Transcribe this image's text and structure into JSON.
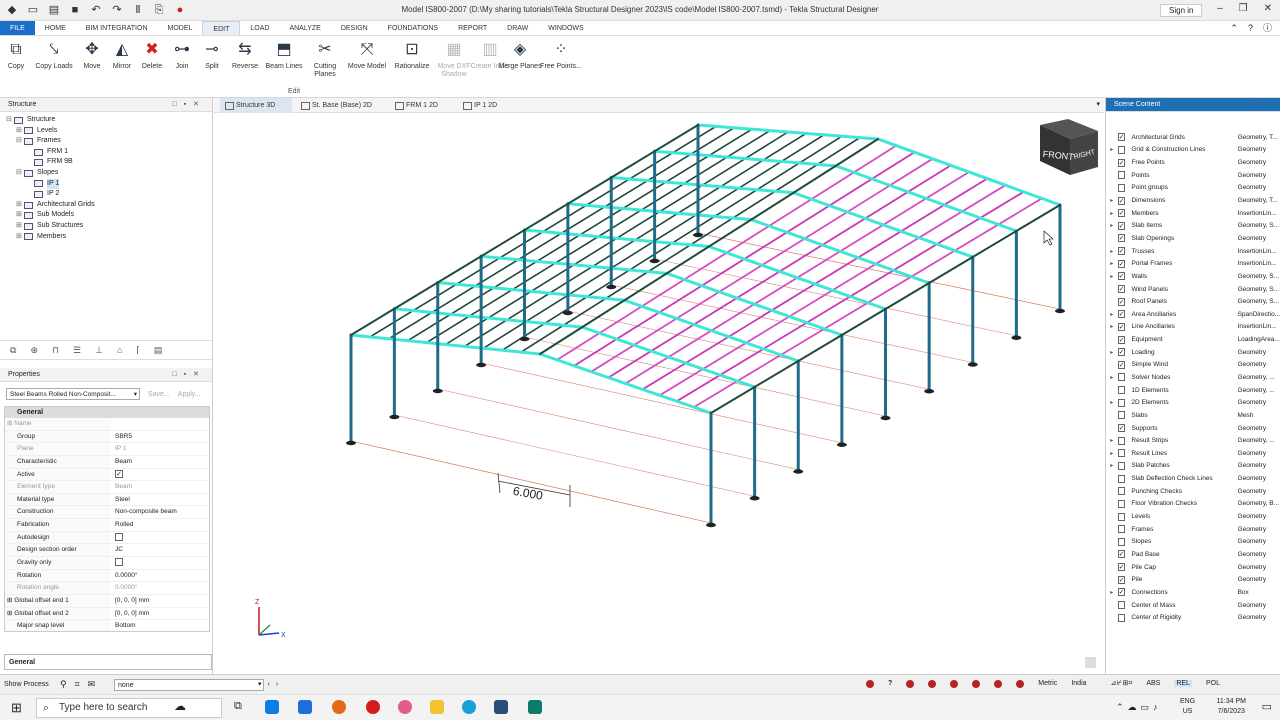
{
  "window": {
    "title": "Model IS800-2007 (D:\\My sharing tutorials\\Tekla Structural Designer 2023\\IS code\\Model IS800-2007.tsmd) - Tekla Structural Designer",
    "sign_in": "Sign in"
  },
  "menu": {
    "tabs": [
      "FILE",
      "HOME",
      "BIM INTEGRATION",
      "MODEL",
      "EDIT",
      "LOAD",
      "ANALYZE",
      "DESIGN",
      "FOUNDATIONS",
      "REPORT",
      "DRAW",
      "WINDOWS"
    ],
    "active": "EDIT"
  },
  "ribbon": {
    "group_label": "Edit",
    "buttons": [
      {
        "label": "Copy",
        "icon": "copy-icon",
        "enabled": true
      },
      {
        "label": "Copy Loads",
        "icon": "copy-loads-icon",
        "enabled": true
      },
      {
        "label": "Move",
        "icon": "move-icon",
        "enabled": true
      },
      {
        "label": "Mirror",
        "icon": "mirror-icon",
        "enabled": true
      },
      {
        "label": "Delete",
        "icon": "delete-icon",
        "enabled": true
      },
      {
        "label": "Join",
        "icon": "join-icon",
        "enabled": true
      },
      {
        "label": "Split",
        "icon": "split-icon",
        "enabled": true
      },
      {
        "label": "Reverse",
        "icon": "reverse-icon",
        "enabled": true
      },
      {
        "label": "Beam Lines",
        "icon": "beam-lines-icon",
        "enabled": true
      },
      {
        "label": "Cutting Planes",
        "icon": "scissors-icon",
        "enabled": true
      },
      {
        "label": "Move Model",
        "icon": "move-model-icon",
        "enabled": true
      },
      {
        "label": "Rationalize",
        "icon": "rationalize-icon",
        "enabled": true
      },
      {
        "label": "Move DXF Shadow",
        "icon": "dxf-icon",
        "enabled": false
      },
      {
        "label": "Create Infills",
        "icon": "infill-icon",
        "enabled": false
      },
      {
        "label": "Merge Planes",
        "icon": "merge-icon",
        "enabled": true
      },
      {
        "label": "Free Points...",
        "icon": "free-points-icon",
        "enabled": true
      }
    ]
  },
  "structure_panel": {
    "title": "Structure",
    "tree": [
      {
        "label": "Structure",
        "level": 0,
        "exp": "−"
      },
      {
        "label": "Levels",
        "level": 1,
        "exp": "+"
      },
      {
        "label": "Frames",
        "level": 1,
        "exp": "−"
      },
      {
        "label": "FRM 1",
        "level": 2,
        "exp": ""
      },
      {
        "label": "FRM 9B",
        "level": 2,
        "exp": ""
      },
      {
        "label": "Slopes",
        "level": 1,
        "exp": "−"
      },
      {
        "label": "IP 1",
        "level": 2,
        "exp": "",
        "selected": true
      },
      {
        "label": "IP 2",
        "level": 2,
        "exp": ""
      },
      {
        "label": "Architectural Grids",
        "level": 1,
        "exp": "+"
      },
      {
        "label": "Sub Models",
        "level": 1,
        "exp": "+"
      },
      {
        "label": "Sub Structures",
        "level": 1,
        "exp": "+"
      },
      {
        "label": "Members",
        "level": 1,
        "exp": "+"
      }
    ]
  },
  "properties": {
    "title": "Properties",
    "selector": "Steel Beams Rolled Non-Composit...",
    "save": "Save...",
    "apply": "Apply...",
    "section": "General",
    "rows": [
      {
        "k": "Name",
        "v": "",
        "dim": true,
        "exp": true
      },
      {
        "k": "Group",
        "v": "SBR5"
      },
      {
        "k": "Plane",
        "v": "IP 1",
        "dim": true
      },
      {
        "k": "Characteristic",
        "v": "Beam"
      },
      {
        "k": "Active",
        "v": "",
        "cb": true,
        "checked": true
      },
      {
        "k": "Element type",
        "v": "Beam",
        "dim": true
      },
      {
        "k": "Material type",
        "v": "Steel"
      },
      {
        "k": "Construction",
        "v": "Non-composite beam"
      },
      {
        "k": "Fabrication",
        "v": "Rolled"
      },
      {
        "k": "Autodesign",
        "v": "",
        "cb": true,
        "checked": false
      },
      {
        "k": "Design section order",
        "v": "JC"
      },
      {
        "k": "Gravity only",
        "v": "",
        "cb": true,
        "checked": false
      },
      {
        "k": "Rotation",
        "v": "0.0000°"
      },
      {
        "k": "Rotation angle",
        "v": "0.0000°",
        "dim": true
      },
      {
        "k": "Global offset end 1",
        "v": "[0, 0, 0] mm",
        "exp": true
      },
      {
        "k": "Global offset end 2",
        "v": "[0, 0, 0] mm",
        "exp": true
      },
      {
        "k": "Major snap level",
        "v": "Bottom"
      }
    ],
    "footer": "General"
  },
  "view_tabs": [
    "Structure 3D",
    "St. Base (Base) 2D",
    "FRM 1 2D",
    "IP 1 2D"
  ],
  "viewport": {
    "dimension": "6.000",
    "nav_cube": {
      "front": "FRONT",
      "right": "RIGHT"
    },
    "axes": {
      "x": "X",
      "z": "Z"
    }
  },
  "scene": {
    "title": "Scene Content",
    "items": [
      {
        "n": "Architectural Grids",
        "t": "Geometry, T...",
        "c": true,
        "e": ""
      },
      {
        "n": "Grid & Construction Lines",
        "t": "Geometry",
        "c": false,
        "e": "▸"
      },
      {
        "n": "Free Points",
        "t": "Geometry",
        "c": true,
        "e": ""
      },
      {
        "n": "Points",
        "t": "Geometry",
        "c": false,
        "e": ""
      },
      {
        "n": "Point groups",
        "t": "Geometry",
        "c": false,
        "e": ""
      },
      {
        "n": "Dimensions",
        "t": "Geometry, T...",
        "c": true,
        "e": "▸"
      },
      {
        "n": "Members",
        "t": "InsertionLin...",
        "c": true,
        "e": "▸"
      },
      {
        "n": "Slab Items",
        "t": "Geometry, S...",
        "c": true,
        "e": "▸"
      },
      {
        "n": "Slab Openings",
        "t": "Geometry",
        "c": true,
        "e": ""
      },
      {
        "n": "Trusses",
        "t": "InsertionLin...",
        "c": true,
        "e": "▸"
      },
      {
        "n": "Portal Frames",
        "t": "InsertionLin...",
        "c": true,
        "e": "▸"
      },
      {
        "n": "Walls",
        "t": "Geometry, S...",
        "c": true,
        "e": "▸"
      },
      {
        "n": "Wind Panels",
        "t": "Geometry, S...",
        "c": true,
        "e": ""
      },
      {
        "n": "Roof Panels",
        "t": "Geometry, S...",
        "c": true,
        "e": ""
      },
      {
        "n": "Area Ancillaries",
        "t": "SpanDirectio...",
        "c": true,
        "e": "▸"
      },
      {
        "n": "Line Ancillaries",
        "t": "InsertionLin...",
        "c": true,
        "e": "▸"
      },
      {
        "n": "Equipment",
        "t": "LoadingArea...",
        "c": true,
        "e": ""
      },
      {
        "n": "Loading",
        "t": "Geometry",
        "c": true,
        "e": "▸"
      },
      {
        "n": "Simple Wind",
        "t": "Geometry",
        "c": true,
        "e": ""
      },
      {
        "n": "Solver Nodes",
        "t": "Geometry, ...",
        "c": false,
        "e": "▸"
      },
      {
        "n": "1D Elements",
        "t": "Geometry, ...",
        "c": false,
        "e": ""
      },
      {
        "n": "2D Elements",
        "t": "Geometry",
        "c": false,
        "e": "▸"
      },
      {
        "n": "Slabs",
        "t": "Mesh",
        "c": false,
        "e": ""
      },
      {
        "n": "Supports",
        "t": "Geometry",
        "c": true,
        "e": ""
      },
      {
        "n": "Result Strips",
        "t": "Geometry, ...",
        "c": false,
        "e": "▸"
      },
      {
        "n": "Result Lines",
        "t": "Geometry",
        "c": false,
        "e": "▸"
      },
      {
        "n": "Slab Patches",
        "t": "Geometry",
        "c": false,
        "e": "▸"
      },
      {
        "n": "Slab Deflection Check Lines",
        "t": "Geometry",
        "c": false,
        "e": ""
      },
      {
        "n": "Punching Checks",
        "t": "Geometry",
        "c": false,
        "e": ""
      },
      {
        "n": "Floor Vibration Checks",
        "t": "Geometry, B...",
        "c": false,
        "e": ""
      },
      {
        "n": "Levels",
        "t": "Geometry",
        "c": false,
        "e": ""
      },
      {
        "n": "Frames",
        "t": "Geometry",
        "c": false,
        "e": ""
      },
      {
        "n": "Slopes",
        "t": "Geometry",
        "c": false,
        "e": ""
      },
      {
        "n": "Pad Base",
        "t": "Geometry",
        "c": true,
        "e": ""
      },
      {
        "n": "Pile Cap",
        "t": "Geometry",
        "c": true,
        "e": ""
      },
      {
        "n": "Pile",
        "t": "Geometry",
        "c": true,
        "e": ""
      },
      {
        "n": "Connections",
        "t": "Box",
        "c": true,
        "e": "▸"
      },
      {
        "n": "Center of Mass",
        "t": "Geometry",
        "c": false,
        "e": ""
      },
      {
        "n": "Center of Rigidity",
        "t": "Geometry",
        "c": false,
        "e": ""
      }
    ]
  },
  "statusbar": {
    "show_process": "Show Process",
    "input": "none",
    "metric": "Metric",
    "region": "India",
    "abs": "ABS",
    "rel": "REL",
    "pol": "POL"
  },
  "taskbar": {
    "search": "Type here to search",
    "lang1": "ENG",
    "lang2": "US",
    "time": "11:34 PM",
    "date": "7/6/2023"
  }
}
